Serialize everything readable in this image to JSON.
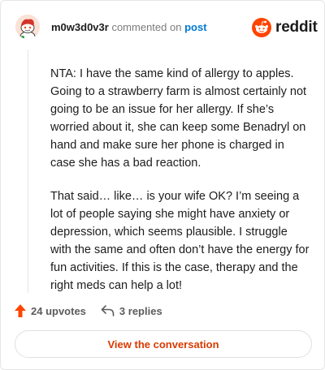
{
  "header": {
    "username": "m0w3d0v3r",
    "action_text": "commented on",
    "post_link": "post"
  },
  "brand": {
    "name": "reddit",
    "logo_icon": "reddit-snoo-icon",
    "brand_color": "#ff4500"
  },
  "comment": {
    "paragraphs": [
      "NTA: I have the same kind of allergy to apples. Going to a strawberry farm is almost certainly not going to be an issue for her allergy. If she’s worried about it, she can keep some Benadryl on hand and make sure her phone is charged in case she has a bad reaction.",
      "That said… like… is your wife OK? I’m seeing a lot of people saying she might have anxiety or depression, which seems plausible. I struggle with the same and often don’t have the energy for fun activities. If this is the case, therapy and the right meds can help a lot!"
    ]
  },
  "actions": {
    "upvotes_label": "24 upvotes",
    "upvote_icon": "upvote-arrow-icon",
    "upvote_color": "#ff4500",
    "replies_label": "3 replies",
    "reply_icon": "reply-arrow-icon"
  },
  "cta": {
    "label": "View the conversation",
    "color": "#d93a00"
  }
}
